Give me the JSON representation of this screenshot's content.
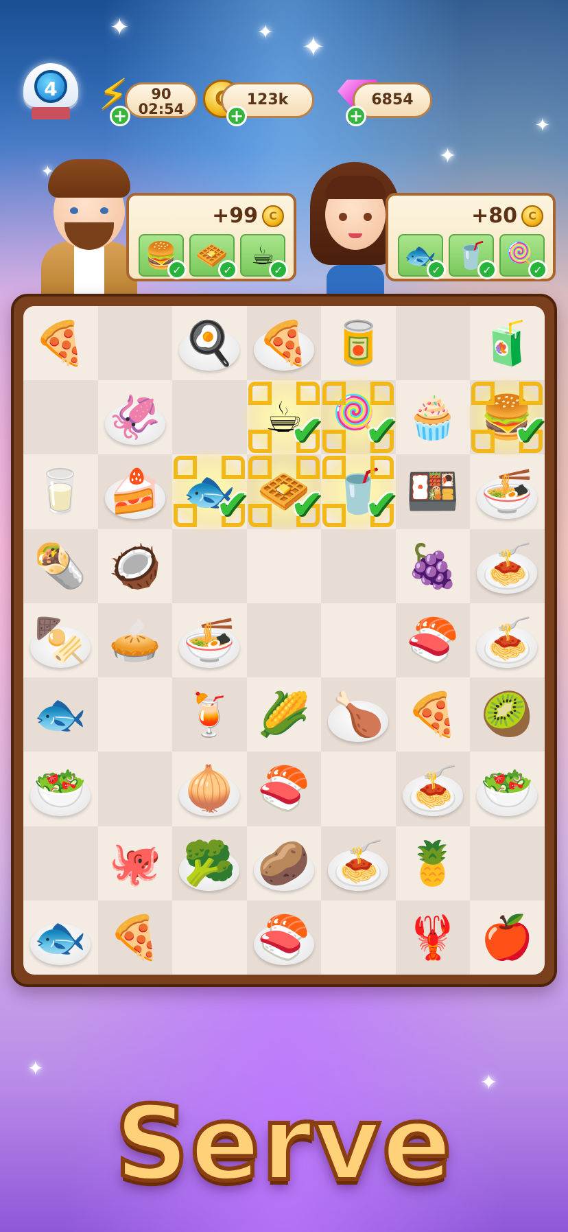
{
  "hud": {
    "level": "4",
    "energy": {
      "value": "90",
      "timer": "02:54",
      "icon": "lightning-bolt-icon"
    },
    "coins": {
      "value": "123k",
      "icon": "gold-coin-icon"
    },
    "gems": {
      "value": "6854",
      "icon": "pink-gem-icon"
    }
  },
  "orders": [
    {
      "character": "chef-man",
      "reward": "+99",
      "items": [
        "🍔",
        "🧇",
        "☕"
      ]
    },
    {
      "character": "woman-customer",
      "reward": "+80",
      "items": [
        "🐟",
        "🥤",
        "🍭"
      ]
    }
  ],
  "board": {
    "columns": 7,
    "rows": 9,
    "tiles": [
      {
        "r": 0,
        "c": 0,
        "f": "🍕",
        "plate": false
      },
      {
        "r": 0,
        "c": 2,
        "f": "🍳",
        "plate": true
      },
      {
        "r": 0,
        "c": 3,
        "f": "🍕",
        "plate": true
      },
      {
        "r": 0,
        "c": 4,
        "f": "🥫",
        "plate": false
      },
      {
        "r": 0,
        "c": 6,
        "f": "🧃",
        "plate": false
      },
      {
        "r": 1,
        "c": 1,
        "f": "🦑",
        "plate": true
      },
      {
        "r": 1,
        "c": 3,
        "f": "☕",
        "plate": false,
        "sel": true
      },
      {
        "r": 1,
        "c": 4,
        "f": "🍭",
        "plate": false,
        "sel": true
      },
      {
        "r": 1,
        "c": 5,
        "f": "🧁",
        "plate": false
      },
      {
        "r": 1,
        "c": 6,
        "f": "🍔",
        "plate": false,
        "sel": true
      },
      {
        "r": 2,
        "c": 0,
        "f": "🥛",
        "plate": false
      },
      {
        "r": 2,
        "c": 1,
        "f": "🍰",
        "plate": true
      },
      {
        "r": 2,
        "c": 2,
        "f": "🐟",
        "plate": false,
        "sel": true
      },
      {
        "r": 2,
        "c": 3,
        "f": "🧇",
        "plate": false,
        "sel": true
      },
      {
        "r": 2,
        "c": 4,
        "f": "🥤",
        "plate": false,
        "sel": true
      },
      {
        "r": 2,
        "c": 5,
        "f": "🍱",
        "plate": false
      },
      {
        "r": 2,
        "c": 6,
        "f": "🍜",
        "plate": true
      },
      {
        "r": 3,
        "c": 0,
        "f": "🌯",
        "plate": false
      },
      {
        "r": 3,
        "c": 1,
        "f": "🥥",
        "plate": false
      },
      {
        "r": 3,
        "c": 5,
        "f": "🍇",
        "plate": false
      },
      {
        "r": 3,
        "c": 6,
        "f": "🍝",
        "plate": true
      },
      {
        "r": 4,
        "c": 0,
        "f": "🍢",
        "plate": true
      },
      {
        "r": 4,
        "c": 1,
        "f": "🥧",
        "plate": false
      },
      {
        "r": 4,
        "c": 2,
        "f": "🍜",
        "plate": true
      },
      {
        "r": 4,
        "c": 5,
        "f": "🍣",
        "plate": false
      },
      {
        "r": 4,
        "c": 6,
        "f": "🍝",
        "plate": true
      },
      {
        "r": 5,
        "c": 0,
        "f": "🐟",
        "plate": false
      },
      {
        "r": 5,
        "c": 2,
        "f": "🍹",
        "plate": false
      },
      {
        "r": 5,
        "c": 3,
        "f": "🌽",
        "plate": false
      },
      {
        "r": 5,
        "c": 4,
        "f": "🍗",
        "plate": true
      },
      {
        "r": 5,
        "c": 5,
        "f": "🍕",
        "plate": false
      },
      {
        "r": 5,
        "c": 6,
        "f": "🥝",
        "plate": false
      },
      {
        "r": 6,
        "c": 0,
        "f": "🥗",
        "plate": true
      },
      {
        "r": 6,
        "c": 2,
        "f": "🧅",
        "plate": true
      },
      {
        "r": 6,
        "c": 3,
        "f": "🍣",
        "plate": false
      },
      {
        "r": 6,
        "c": 5,
        "f": "🍝",
        "plate": true
      },
      {
        "r": 6,
        "c": 6,
        "f": "🥗",
        "plate": true
      },
      {
        "r": 7,
        "c": 1,
        "f": "🐙",
        "plate": false
      },
      {
        "r": 7,
        "c": 2,
        "f": "🥦",
        "plate": true
      },
      {
        "r": 7,
        "c": 3,
        "f": "🥔",
        "plate": true
      },
      {
        "r": 7,
        "c": 4,
        "f": "🍝",
        "plate": true
      },
      {
        "r": 7,
        "c": 5,
        "f": "🍍",
        "plate": false
      },
      {
        "r": 8,
        "c": 0,
        "f": "🐟",
        "plate": true
      },
      {
        "r": 8,
        "c": 1,
        "f": "🍕",
        "plate": false
      },
      {
        "r": 8,
        "c": 3,
        "f": "🍣",
        "plate": true
      },
      {
        "r": 8,
        "c": 5,
        "f": "🦞",
        "plate": false
      },
      {
        "r": 8,
        "c": 6,
        "f": "🍎",
        "plate": false
      }
    ]
  },
  "title": "Serve",
  "colors": {
    "board_frame": "#7a3f1c",
    "check": "#37c23a",
    "highlight": "#f2b819",
    "title_fill": "#ffd27a"
  }
}
